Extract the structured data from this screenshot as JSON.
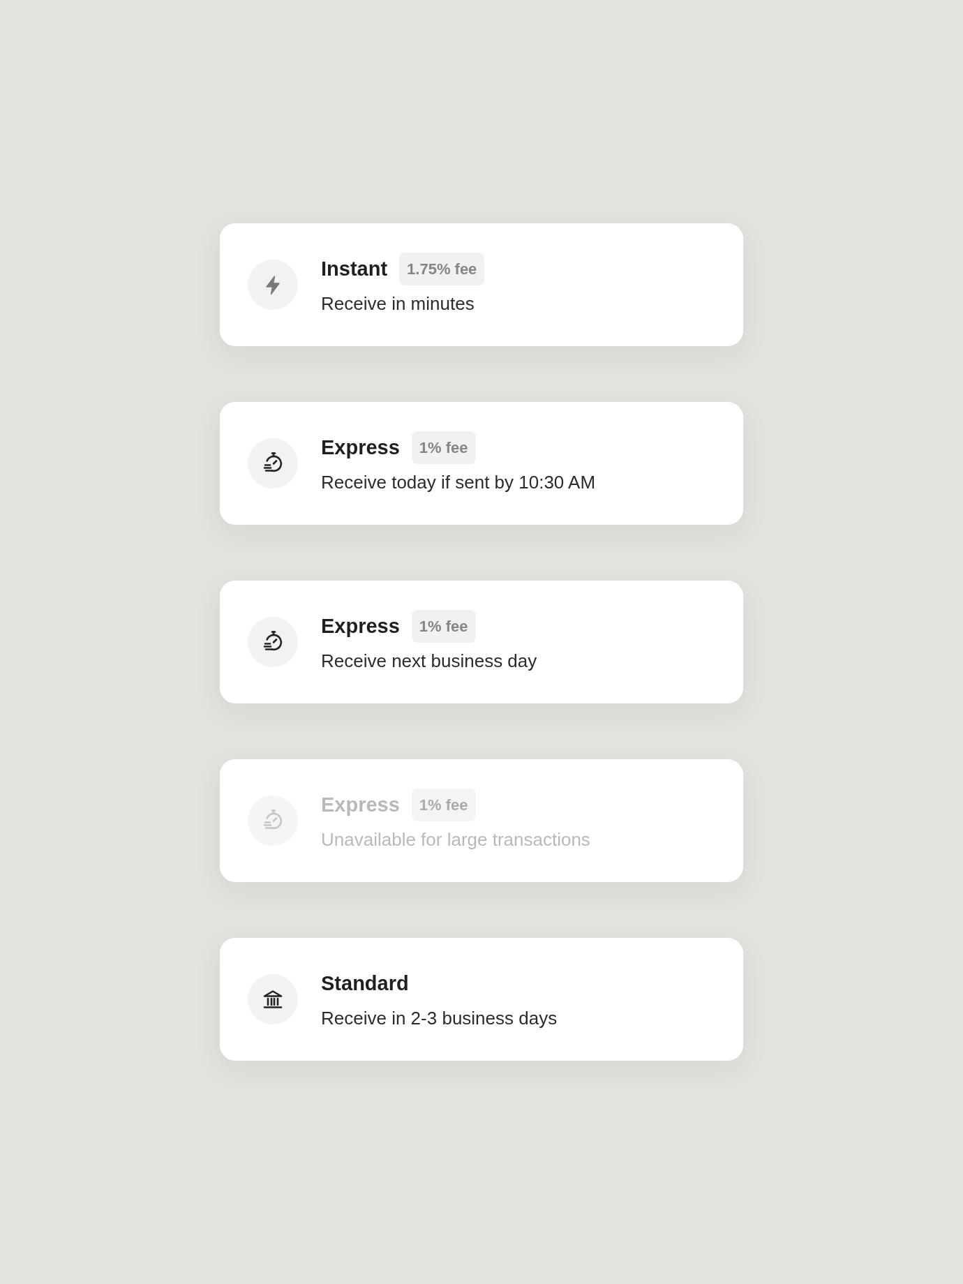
{
  "options": [
    {
      "kind": "instant",
      "title": "Instant",
      "fee": "1.75% fee",
      "description": "Receive in minutes",
      "disabled": false
    },
    {
      "kind": "express",
      "title": "Express",
      "fee": "1% fee",
      "description": "Receive today if sent by 10:30 AM",
      "disabled": false
    },
    {
      "kind": "express",
      "title": "Express",
      "fee": "1% fee",
      "description": "Receive next business day",
      "disabled": false
    },
    {
      "kind": "express",
      "title": "Express",
      "fee": "1% fee",
      "description": "Unavailable for large transactions",
      "disabled": true
    },
    {
      "kind": "standard",
      "title": "Standard",
      "description": "Receive in 2-3 business days",
      "disabled": false
    }
  ]
}
